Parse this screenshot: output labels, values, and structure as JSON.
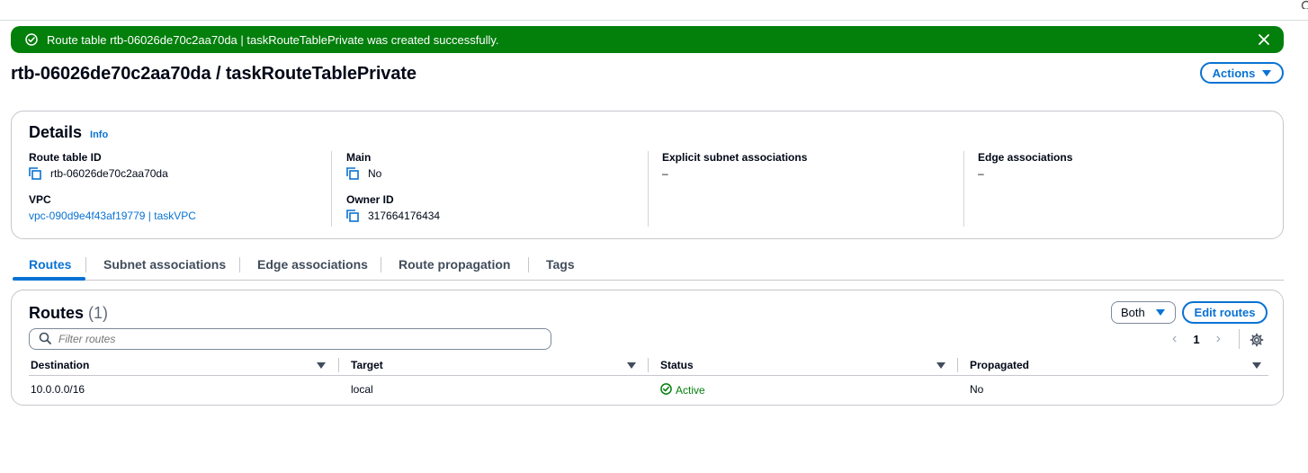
{
  "flash": {
    "message": "Route table rtb-06026de70c2aa70da | taskRouteTablePrivate was created successfully."
  },
  "header": {
    "title": "rtb-06026de70c2aa70da / taskRouteTablePrivate",
    "actions_label": "Actions"
  },
  "details": {
    "title": "Details",
    "info_label": "Info",
    "route_table_id_label": "Route table ID",
    "route_table_id": "rtb-06026de70c2aa70da",
    "vpc_label": "VPC",
    "vpc_value": "vpc-090d9e4f43af19779 | taskVPC",
    "main_label": "Main",
    "main_value": "No",
    "owner_label": "Owner ID",
    "owner_value": "317664176434",
    "explicit_label": "Explicit subnet associations",
    "explicit_value": "–",
    "edge_label": "Edge associations",
    "edge_value": "–"
  },
  "tabs": [
    {
      "label": "Routes",
      "active": true
    },
    {
      "label": "Subnet associations",
      "active": false
    },
    {
      "label": "Edge associations",
      "active": false
    },
    {
      "label": "Route propagation",
      "active": false
    },
    {
      "label": "Tags",
      "active": false
    }
  ],
  "routes": {
    "title": "Routes",
    "count": "(1)",
    "filter_select_value": "Both",
    "edit_label": "Edit routes",
    "filter_placeholder": "Filter routes",
    "page": "1",
    "columns": [
      "Destination",
      "Target",
      "Status",
      "Propagated"
    ],
    "rows": [
      {
        "destination": "10.0.0.0/16",
        "target": "local",
        "status": "Active",
        "propagated": "No"
      }
    ]
  },
  "colors": {
    "accent": "#0972d3",
    "success": "#037f0c",
    "text": "#000716"
  }
}
